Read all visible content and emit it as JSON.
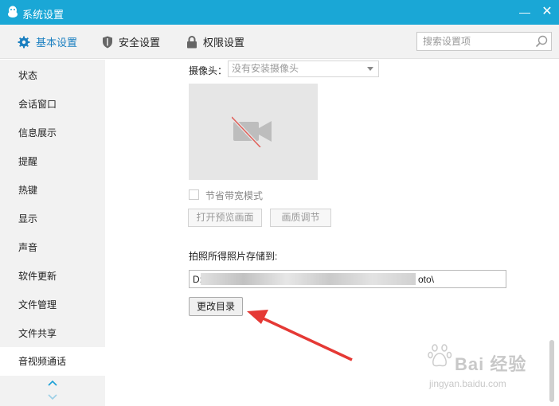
{
  "window": {
    "title": "系统设置",
    "minimize_glyph": "—",
    "close_glyph": "✕",
    "titlebar_color": "#1aa7d6"
  },
  "tabs": [
    {
      "label": "基本设置",
      "icon": "gear-icon",
      "active": true
    },
    {
      "label": "安全设置",
      "icon": "shield-icon",
      "active": false
    },
    {
      "label": "权限设置",
      "icon": "lock-icon",
      "active": false
    }
  ],
  "search": {
    "placeholder": "搜索设置项",
    "value": ""
  },
  "sidebar": {
    "items": [
      {
        "label": "状态"
      },
      {
        "label": "会话窗口"
      },
      {
        "label": "信息展示"
      },
      {
        "label": "提醒"
      },
      {
        "label": "热键"
      },
      {
        "label": "显示"
      },
      {
        "label": "声音"
      },
      {
        "label": "软件更新"
      },
      {
        "label": "文件管理"
      },
      {
        "label": "文件共享"
      },
      {
        "label": "音视频通话",
        "active": true
      }
    ]
  },
  "camera": {
    "label": "摄像头：",
    "selected": "没有安装摄像头",
    "bandwidth_label": "节省带宽模式",
    "bandwidth_checked": false,
    "preview_button": "打开预览画面",
    "quality_button": "画质调节"
  },
  "photo": {
    "save_label": "拍照所得照片存储到:",
    "path_start": "D:",
    "path_end": "oto\\",
    "change_button": "更改目录"
  },
  "watermark": {
    "text": "Bai 经验",
    "url": "jingyan.baidu.com"
  },
  "colors": {
    "accent": "#1a7fc0",
    "annotation": "#e53935"
  }
}
